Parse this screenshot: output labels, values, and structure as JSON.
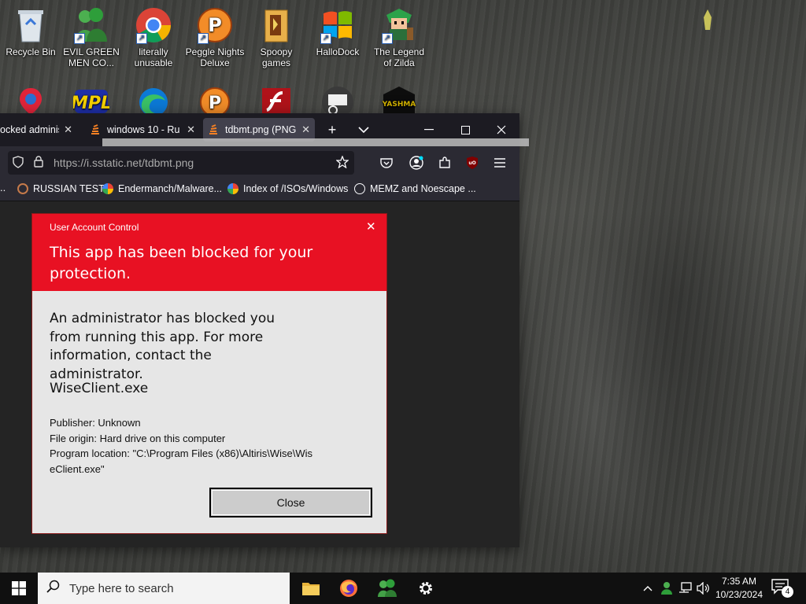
{
  "desktop": {
    "icons": [
      {
        "label": "Recycle Bin",
        "icon": "recycle-bin-icon"
      },
      {
        "label": "EVIL GREEN MEN CO...",
        "icon": "green-men-icon"
      },
      {
        "label": "literally unusable",
        "icon": "chrome-icon"
      },
      {
        "label": "Peggle Nights Deluxe",
        "icon": "peggle-icon"
      },
      {
        "label": "Spoopy games",
        "icon": "folder-icon"
      },
      {
        "label": "HalloDock",
        "icon": "windows-logo-icon"
      },
      {
        "label": "The Legend of Zilda",
        "icon": "zilda-icon"
      }
    ],
    "row2_icons": [
      "maps-icon",
      "mpl-icon",
      "edge-icon",
      "peggle-icon",
      "flash-icon",
      "remote-desktop-icon",
      "yashma-icon"
    ],
    "row2_yashma_text": "YASHMA"
  },
  "browser": {
    "tabs": [
      {
        "label": "ocked administ",
        "active": false
      },
      {
        "label": "windows 10 - Ru",
        "active": false
      },
      {
        "label": "tdbmt.png (PNG",
        "active": true
      }
    ],
    "new_tab": "+",
    "tab_list": "⌄",
    "window_controls": {
      "minimize": "—",
      "maximize": "☐",
      "close": "✕"
    },
    "url": "https://i.sstatic.net/tdbmt.png",
    "bookmarks": [
      {
        "label": "RUSSIAN TEST"
      },
      {
        "label": "Endermanch/Malware..."
      },
      {
        "label": "Index of /ISOs/Windows"
      },
      {
        "label": "MEMZ and Noescape ..."
      }
    ]
  },
  "uac": {
    "caption": "User Account Control",
    "title": "This app has been blocked for your protection.",
    "message": "An administrator has blocked you from running this app. For more information, contact the administrator.",
    "app_name": "WiseClient.exe",
    "publisher": "Publisher: Unknown",
    "file_origin": "File origin: Hard drive on this computer",
    "program_location": "Program location: \"C:\\Program Files (x86)\\Altiris\\Wise\\WiseClient.exe\"",
    "close_label": "Close",
    "accent": "#e81123"
  },
  "taskbar": {
    "search_placeholder": "Type here to search",
    "time": "7:35 AM",
    "date": "10/23/2024",
    "notification_count": "4"
  }
}
